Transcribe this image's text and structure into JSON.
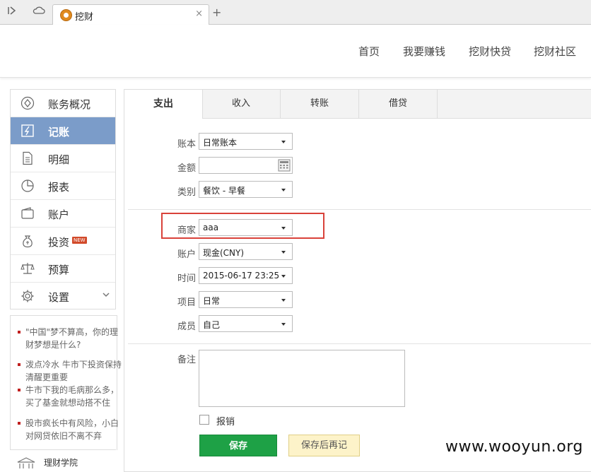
{
  "browser": {
    "tab_title": "挖财",
    "back_icon": "sidebar-toggle-icon",
    "cloud_icon": "cloud-icon",
    "close_glyph": "×",
    "newtab_glyph": "+"
  },
  "header": {
    "nav": [
      "首页",
      "我要赚钱",
      "挖财快贷",
      "挖财社区"
    ]
  },
  "sidebar": {
    "items": [
      {
        "label": "账务概况",
        "icon": "overview-icon"
      },
      {
        "label": "记账",
        "icon": "bookkeeping-icon",
        "active": true
      },
      {
        "label": "明细",
        "icon": "document-icon"
      },
      {
        "label": "报表",
        "icon": "pie-chart-icon"
      },
      {
        "label": "账户",
        "icon": "wallet-icon"
      },
      {
        "label": "投资",
        "icon": "money-bag-icon",
        "badge": "NEW"
      },
      {
        "label": "预算",
        "icon": "scale-icon"
      },
      {
        "label": "设置",
        "icon": "gear-icon",
        "chevron": "⌄"
      }
    ]
  },
  "news": [
    "\"中国\"梦不算高，你的理财梦想是什么?",
    "泼点冷水 牛市下投资保持清醒更重要",
    "牛市下我的毛病那么多，买了基金就想动搭不住",
    "股市疯长中有风险，小白对网贷依旧不离不弃"
  ],
  "academy": {
    "label": "理财学院"
  },
  "form": {
    "tabs": [
      "支出",
      "收入",
      "转账",
      "借贷"
    ],
    "account_book": {
      "label": "账本",
      "value": "日常账本"
    },
    "amount": {
      "label": "金额",
      "value": ""
    },
    "category": {
      "label": "类别",
      "value": "餐饮 - 早餐"
    },
    "merchant": {
      "label": "商家",
      "value": "aaa"
    },
    "account": {
      "label": "账户",
      "value": "现金(CNY)"
    },
    "time": {
      "label": "时间",
      "value": "2015-06-17 23:25"
    },
    "project": {
      "label": "项目",
      "value": "日常"
    },
    "member": {
      "label": "成员",
      "value": "自己"
    },
    "memo": {
      "label": "备注",
      "value": ""
    },
    "reimburse": {
      "label": "报销",
      "checked": false
    },
    "save_label": "保存",
    "save_again_label": "保存后再记"
  },
  "watermark": "www.wooyun.org",
  "colors": {
    "active": "#7b9cc9",
    "save": "#1ea146",
    "highlight": "#d9423a",
    "accent_red": "#c0201f"
  }
}
